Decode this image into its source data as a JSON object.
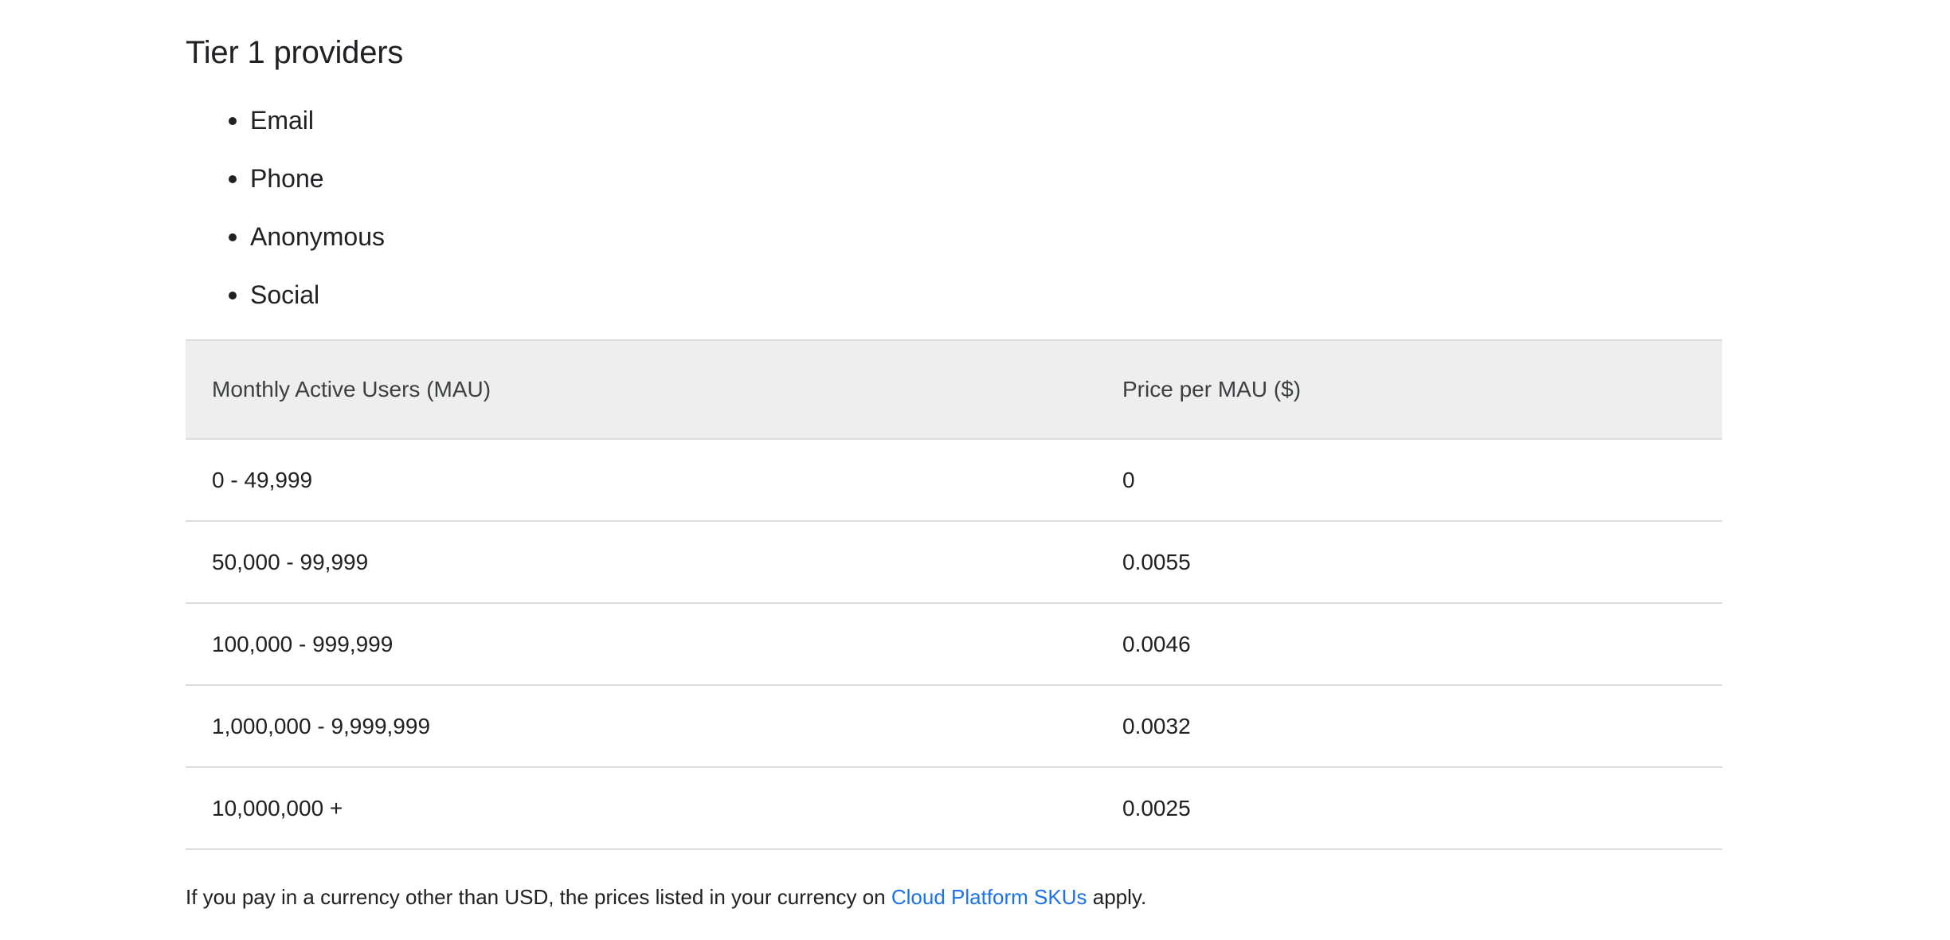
{
  "section": {
    "title": "Tier 1 providers"
  },
  "providers": [
    "Email",
    "Phone",
    "Anonymous",
    "Social"
  ],
  "table": {
    "headers": [
      "Monthly Active Users (MAU)",
      "Price per MAU ($)"
    ],
    "rows": [
      [
        "0 - 49,999",
        "0"
      ],
      [
        "50,000 - 99,999",
        "0.0055"
      ],
      [
        "100,000 - 999,999",
        "0.0046"
      ],
      [
        "1,000,000 - 9,999,999",
        "0.0032"
      ],
      [
        "10,000,000 +",
        "0.0025"
      ]
    ]
  },
  "footnote": {
    "before_link": "If you pay in a currency other than USD, the prices listed in your currency on ",
    "link_text": "Cloud Platform SKUs",
    "after_link": " apply."
  },
  "colors": {
    "text": "#202124",
    "link": "#1a73e8",
    "header_background": "#eeeeee",
    "divider": "#dadce0"
  }
}
